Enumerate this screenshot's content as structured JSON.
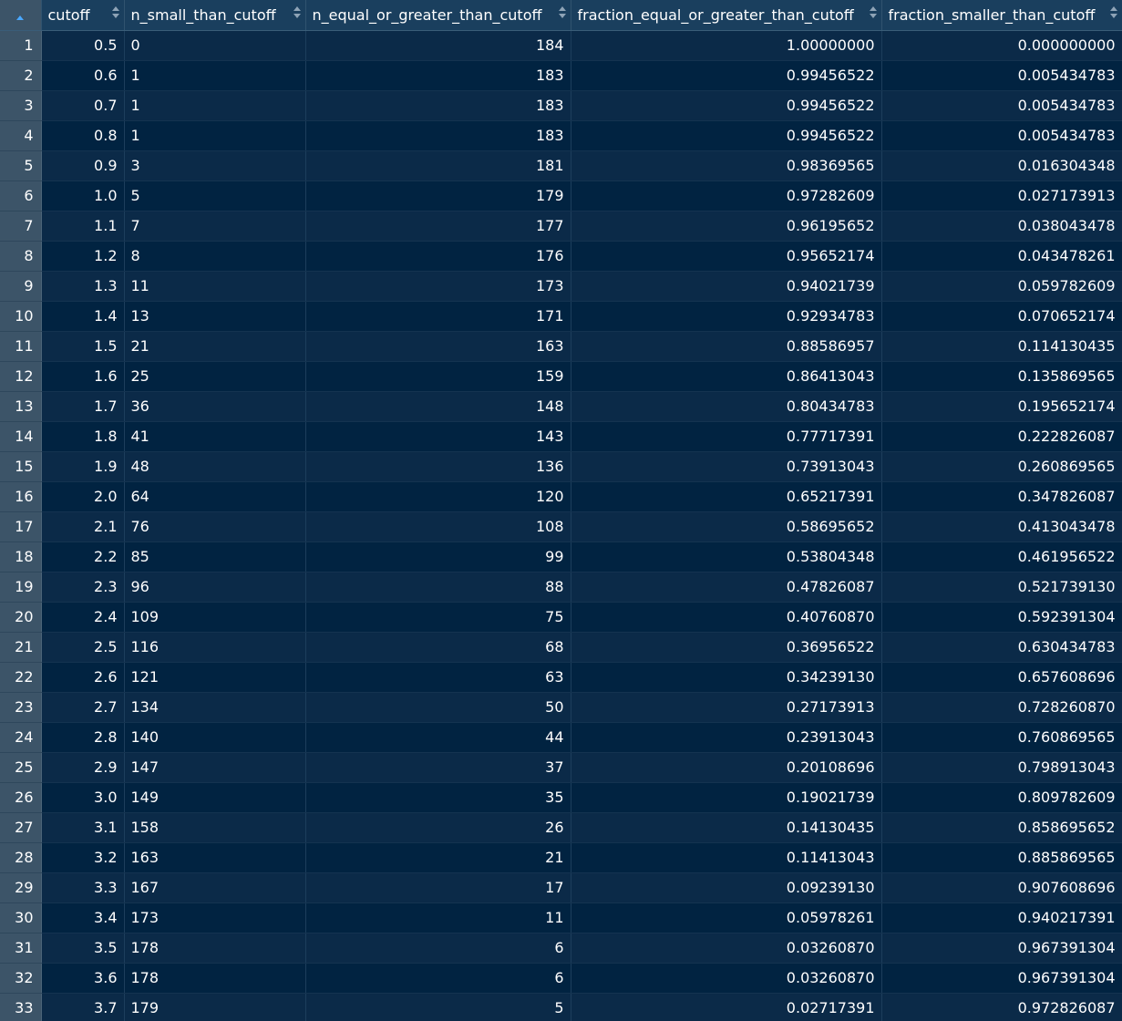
{
  "table": {
    "columns": [
      {
        "key": "cutoff",
        "label": "cutoff",
        "align": "right"
      },
      {
        "key": "n_small",
        "label": "n_small_than_cutoff",
        "align": "left"
      },
      {
        "key": "n_ge",
        "label": "n_equal_or_greater_than_cutoff",
        "align": "right"
      },
      {
        "key": "frac_ge",
        "label": "fraction_equal_or_greater_than_cutoff",
        "align": "right"
      },
      {
        "key": "frac_small",
        "label": "fraction_smaller_than_cutoff",
        "align": "right"
      }
    ],
    "rows": [
      [
        "1",
        "0.5",
        "0",
        "184",
        "1.00000000",
        "0.000000000"
      ],
      [
        "2",
        "0.6",
        "1",
        "183",
        "0.99456522",
        "0.005434783"
      ],
      [
        "3",
        "0.7",
        "1",
        "183",
        "0.99456522",
        "0.005434783"
      ],
      [
        "4",
        "0.8",
        "1",
        "183",
        "0.99456522",
        "0.005434783"
      ],
      [
        "5",
        "0.9",
        "3",
        "181",
        "0.98369565",
        "0.016304348"
      ],
      [
        "6",
        "1.0",
        "5",
        "179",
        "0.97282609",
        "0.027173913"
      ],
      [
        "7",
        "1.1",
        "7",
        "177",
        "0.96195652",
        "0.038043478"
      ],
      [
        "8",
        "1.2",
        "8",
        "176",
        "0.95652174",
        "0.043478261"
      ],
      [
        "9",
        "1.3",
        "11",
        "173",
        "0.94021739",
        "0.059782609"
      ],
      [
        "10",
        "1.4",
        "13",
        "171",
        "0.92934783",
        "0.070652174"
      ],
      [
        "11",
        "1.5",
        "21",
        "163",
        "0.88586957",
        "0.114130435"
      ],
      [
        "12",
        "1.6",
        "25",
        "159",
        "0.86413043",
        "0.135869565"
      ],
      [
        "13",
        "1.7",
        "36",
        "148",
        "0.80434783",
        "0.195652174"
      ],
      [
        "14",
        "1.8",
        "41",
        "143",
        "0.77717391",
        "0.222826087"
      ],
      [
        "15",
        "1.9",
        "48",
        "136",
        "0.73913043",
        "0.260869565"
      ],
      [
        "16",
        "2.0",
        "64",
        "120",
        "0.65217391",
        "0.347826087"
      ],
      [
        "17",
        "2.1",
        "76",
        "108",
        "0.58695652",
        "0.413043478"
      ],
      [
        "18",
        "2.2",
        "85",
        "99",
        "0.53804348",
        "0.461956522"
      ],
      [
        "19",
        "2.3",
        "96",
        "88",
        "0.47826087",
        "0.521739130"
      ],
      [
        "20",
        "2.4",
        "109",
        "75",
        "0.40760870",
        "0.592391304"
      ],
      [
        "21",
        "2.5",
        "116",
        "68",
        "0.36956522",
        "0.630434783"
      ],
      [
        "22",
        "2.6",
        "121",
        "63",
        "0.34239130",
        "0.657608696"
      ],
      [
        "23",
        "2.7",
        "134",
        "50",
        "0.27173913",
        "0.728260870"
      ],
      [
        "24",
        "2.8",
        "140",
        "44",
        "0.23913043",
        "0.760869565"
      ],
      [
        "25",
        "2.9",
        "147",
        "37",
        "0.20108696",
        "0.798913043"
      ],
      [
        "26",
        "3.0",
        "149",
        "35",
        "0.19021739",
        "0.809782609"
      ],
      [
        "27",
        "3.1",
        "158",
        "26",
        "0.14130435",
        "0.858695652"
      ],
      [
        "28",
        "3.2",
        "163",
        "21",
        "0.11413043",
        "0.885869565"
      ],
      [
        "29",
        "3.3",
        "167",
        "17",
        "0.09239130",
        "0.907608696"
      ],
      [
        "30",
        "3.4",
        "173",
        "11",
        "0.05978261",
        "0.940217391"
      ],
      [
        "31",
        "3.5",
        "178",
        "6",
        "0.03260870",
        "0.967391304"
      ],
      [
        "32",
        "3.6",
        "178",
        "6",
        "0.03260870",
        "0.967391304"
      ],
      [
        "33",
        "3.7",
        "179",
        "5",
        "0.02717391",
        "0.972826087"
      ]
    ]
  },
  "colors": {
    "background": "#002240",
    "header_background": "#1a3f5e",
    "rownum_background": "#3c5468",
    "row_odd": "#0b2a48",
    "row_even": "#012341",
    "sort_active": "#4aa8ff"
  },
  "icons": {
    "rownum_header": "sort-ascending-icon",
    "column_header": "sort-toggle-icon"
  }
}
